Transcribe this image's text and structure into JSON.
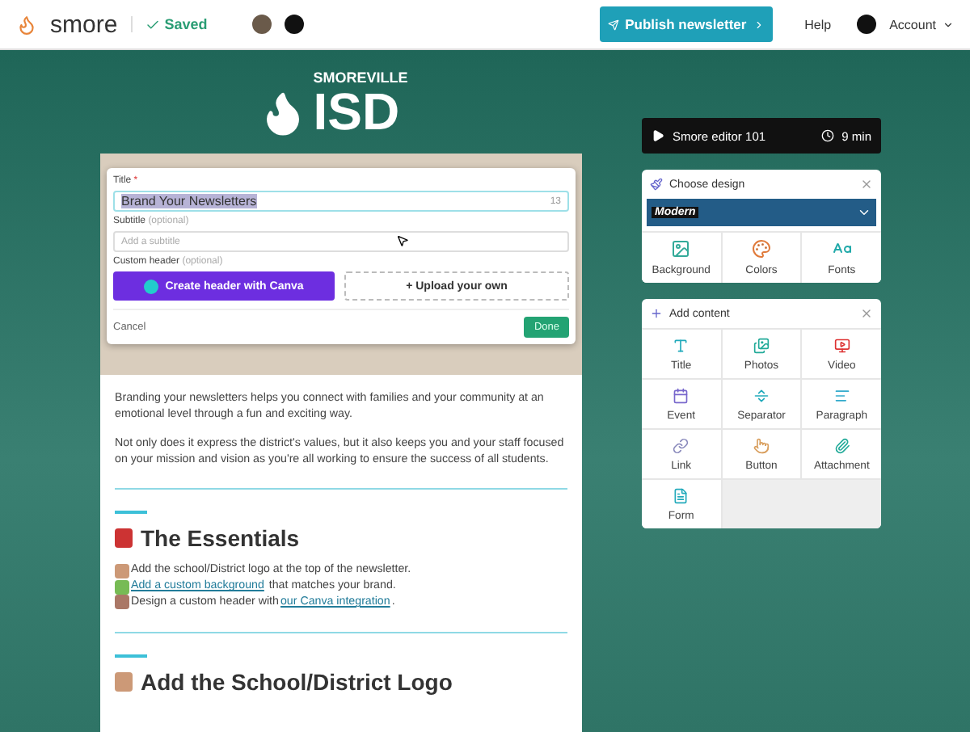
{
  "topbar": {
    "brand": "smore",
    "status": "Saved",
    "publish": "Publish newsletter",
    "help": "Help",
    "account": "Account"
  },
  "logo": {
    "top": "SMOREVILLE",
    "main": "ISD"
  },
  "header_editor": {
    "title_label": "Title",
    "required_mark": "*",
    "title_value": "Brand Your Newsletters",
    "title_count": "13",
    "subtitle_label": "Subtitle",
    "subtitle_hint": "(optional)",
    "subtitle_placeholder": "Add a subtitle",
    "custom_label": "Custom header",
    "custom_hint": "(optional)",
    "canva_button": "Create header with Canva",
    "upload_button": "+ Upload your own",
    "cancel": "Cancel",
    "done": "Done"
  },
  "body": {
    "paragraphs": [
      "Branding your newsletters helps you connect with families and your community at an emotional level through a fun and exciting way.",
      "Not only does it express the district's values, but it also keeps you and your staff focused on your mission and vision as you're all working to ensure the success of all students."
    ],
    "section_title": "The Essentials",
    "list": [
      {
        "before": "Add the school/District logo at the top of the newsletter."
      },
      {
        "link": "Add a custom background",
        "after": " that matches your brand."
      },
      {
        "before": "Design a custom header with ",
        "link": "our Canva integration",
        "after": "."
      }
    ],
    "next_title": "Add the School/District Logo"
  },
  "video": {
    "label": "Smore editor 101",
    "duration": "9 min"
  },
  "design": {
    "title": "Choose design",
    "theme": "Modern",
    "options": [
      {
        "kind": "background",
        "label": "Background"
      },
      {
        "kind": "colors",
        "label": "Colors"
      },
      {
        "kind": "fonts",
        "label": "Fonts"
      }
    ]
  },
  "content": {
    "title": "Add content",
    "items": [
      {
        "kind": "title",
        "label": "Title"
      },
      {
        "kind": "photos",
        "label": "Photos"
      },
      {
        "kind": "video",
        "label": "Video"
      },
      {
        "kind": "event",
        "label": "Event"
      },
      {
        "kind": "separator",
        "label": "Separator"
      },
      {
        "kind": "paragraph",
        "label": "Paragraph"
      },
      {
        "kind": "link",
        "label": "Link"
      },
      {
        "kind": "button",
        "label": "Button"
      },
      {
        "kind": "attachment",
        "label": "Attachment"
      },
      {
        "kind": "form",
        "label": "Form"
      }
    ]
  }
}
